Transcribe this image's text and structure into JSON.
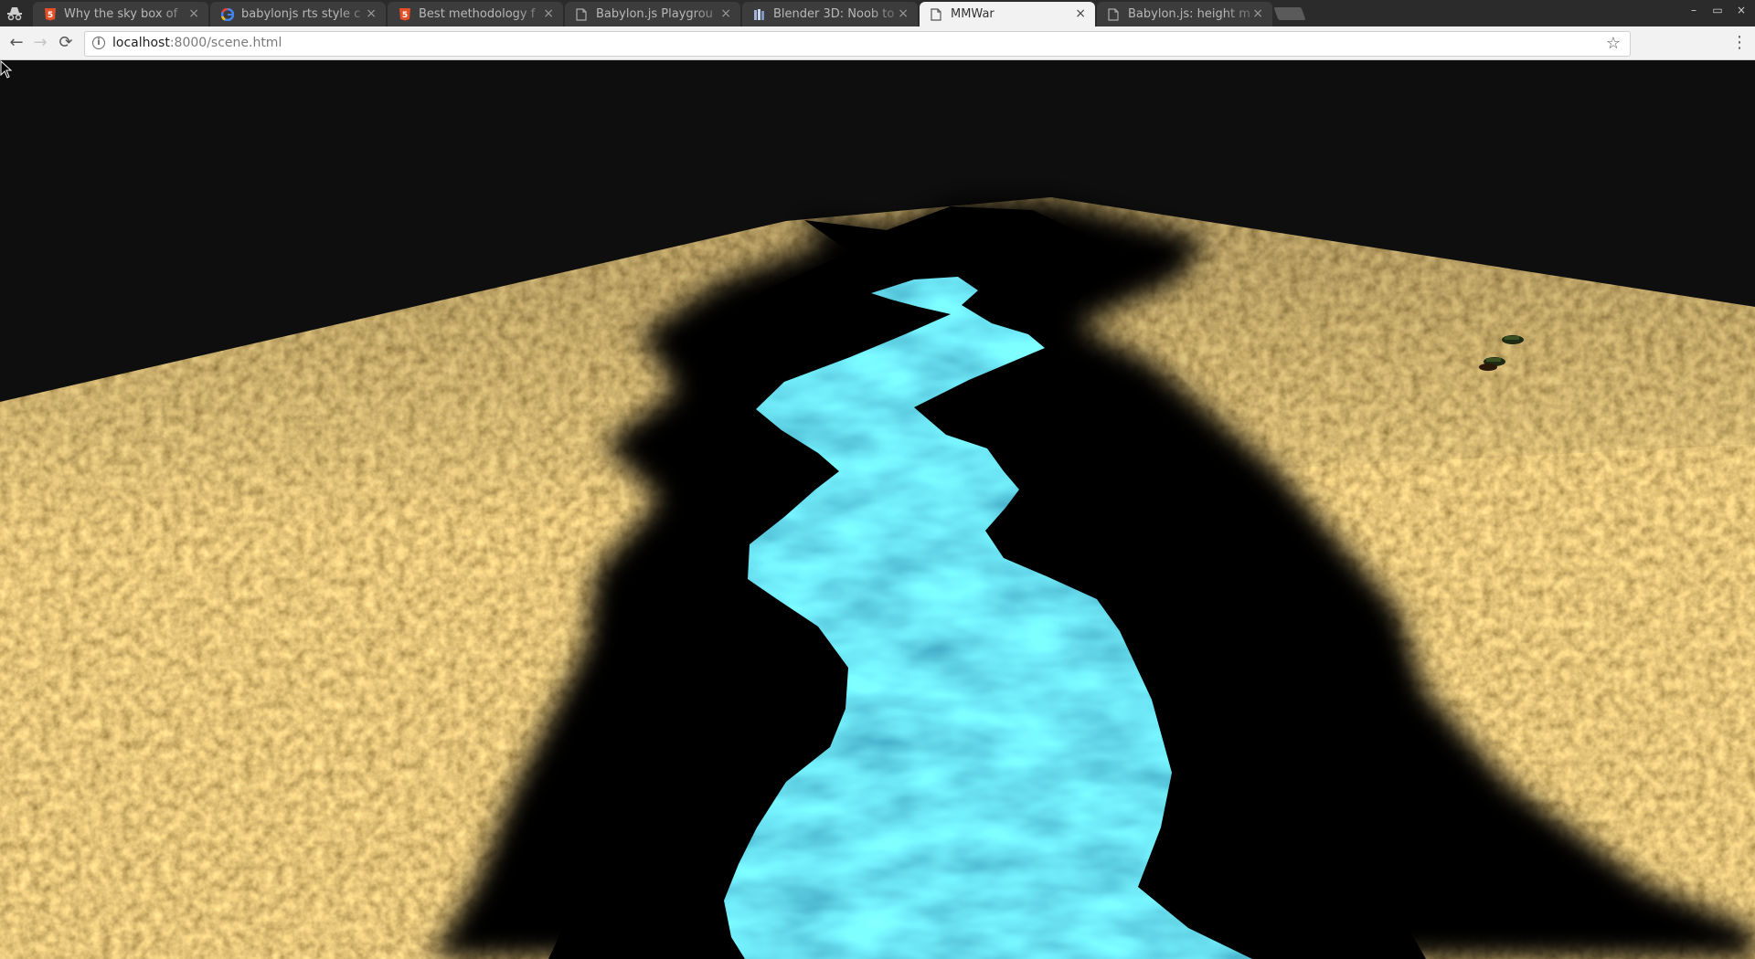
{
  "browser": {
    "tabs": [
      {
        "title": "Why the sky box of",
        "favicon": "html5-icon",
        "active": false
      },
      {
        "title": "babylonjs rts style c",
        "favicon": "google-icon",
        "active": false
      },
      {
        "title": "Best methodology f",
        "favicon": "html5-icon",
        "active": false
      },
      {
        "title": "Babylon.js Playgrou",
        "favicon": "page-icon",
        "active": false
      },
      {
        "title": "Blender 3D: Noob to",
        "favicon": "wikibooks-icon",
        "active": false
      },
      {
        "title": "MMWar",
        "favicon": "page-icon",
        "active": true
      },
      {
        "title": "Babylon.js: height m",
        "favicon": "page-icon",
        "active": false
      }
    ],
    "tab_close_glyph": "×",
    "address": {
      "host": "localhost",
      "rest": ":8000/scene.html"
    },
    "icons": {
      "back": "back-arrow-icon",
      "forward": "forward-arrow-icon",
      "reload": "reload-icon",
      "info": "info-icon",
      "bookmark": "star-icon",
      "menu": "kebab-menu-icon",
      "incognito": "incognito-icon"
    },
    "glyphs": {
      "back": "←",
      "forward": "→",
      "reload": "⟳",
      "info": "i",
      "star": "☆",
      "menu": "⋮"
    },
    "window_controls": [
      "–",
      "▭",
      "×"
    ]
  },
  "scene": {
    "description_colors": {
      "sky": "#0e0e0e",
      "sand": "#b88a3c",
      "sand_dark": "#7a5420",
      "shadow": "#000000",
      "water": "#2ea9d3",
      "water_light": "#7fe0e0"
    }
  }
}
